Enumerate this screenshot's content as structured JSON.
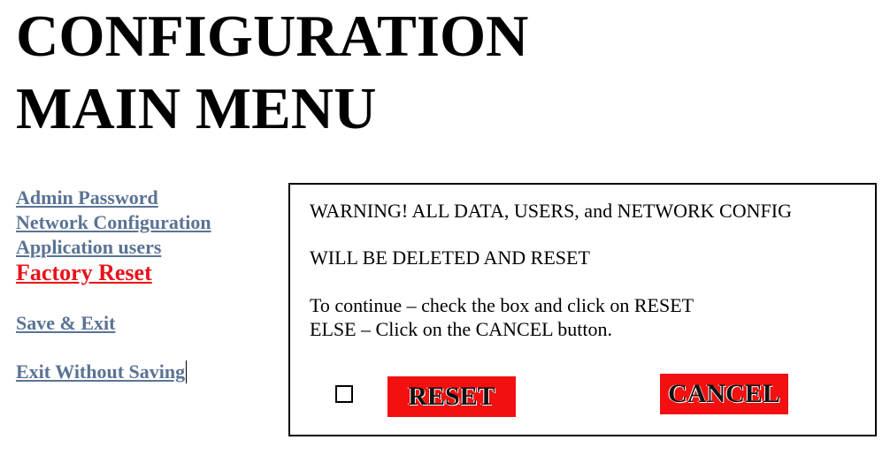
{
  "title": {
    "line1": "CONFIGURATION",
    "line2": "MAIN MENU"
  },
  "nav": {
    "admin_password": "Admin Password",
    "network_configuration": "Network Configuration",
    "application_users": "Application users",
    "factory_reset": "Factory Reset",
    "save_exit": "Save & Exit",
    "exit_without_saving": "Exit Without Saving"
  },
  "dialog": {
    "warning_line1": "WARNING!  ALL DATA, USERS, and NETWORK CONFIG",
    "warning_line2": "WILL BE DELETED AND RESET",
    "instruction_line1": "To continue – check the box and click on RESET",
    "instruction_line2": "ELSE – Click on the CANCEL button.",
    "reset_label": "RESET",
    "cancel_label": "CANCEL",
    "confirm_checked": false
  },
  "colors": {
    "link": "#5a7394",
    "active_link": "#e8121a",
    "button_red": "#f21010"
  }
}
